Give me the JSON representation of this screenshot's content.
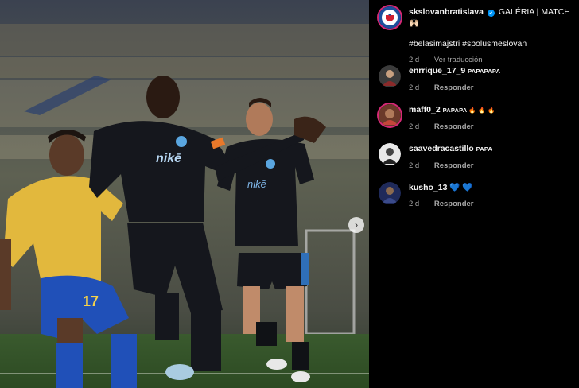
{
  "post": {
    "author": "skslovanbratislava",
    "caption": "GALÉRIA | MATCH 🙌🏻",
    "hashtags": "#belasimajstri #spolusmeslovan",
    "age": "2 d",
    "translate_label": "Ver traducción",
    "jersey_sponsor": "nikē",
    "jersey_number": "17"
  },
  "next_label": "›",
  "reply_label": "Responder",
  "comments": [
    {
      "user": "enrrique_17_9",
      "text": "PAPAPAPA",
      "age": "2 d"
    },
    {
      "user": "maff0_2",
      "text": "PAPAPA 🔥 🔥 🔥",
      "age": "2 d"
    },
    {
      "user": "saavedracastillo",
      "text": "PAPA",
      "age": "2 d"
    },
    {
      "user": "kusho_13",
      "text": "💙 💙",
      "age": "2 d"
    }
  ],
  "colors": {
    "accent_blue": "#0095f6",
    "muted_text": "#a8a8a8",
    "kit_dark": "#15171d",
    "kit_yellow": "#e2b83d"
  }
}
